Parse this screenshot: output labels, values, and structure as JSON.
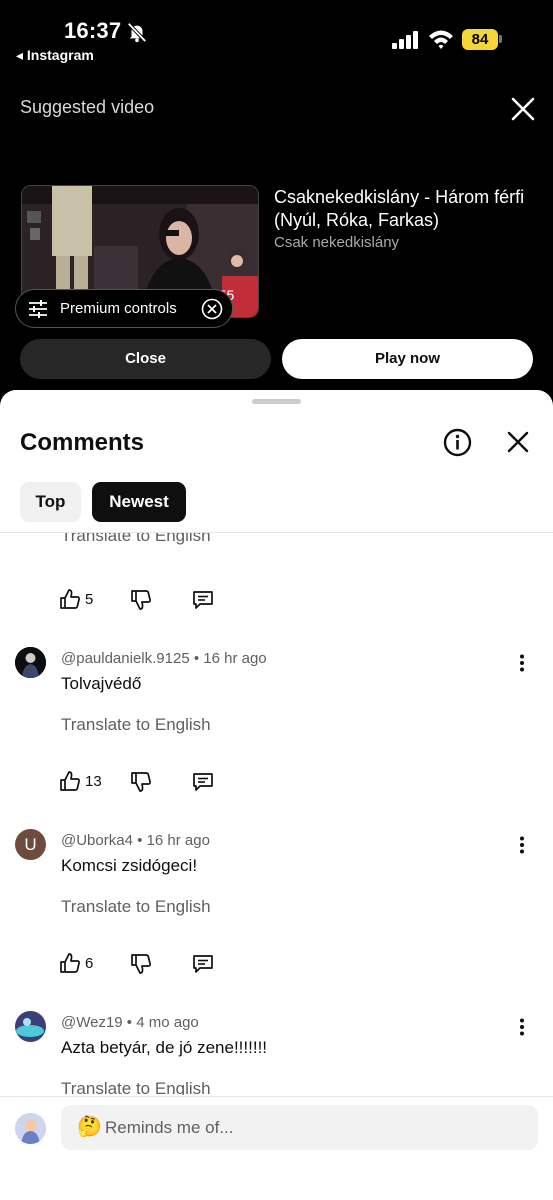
{
  "status_bar": {
    "time": "16:37",
    "back_app": "◂ Instagram",
    "battery": "84"
  },
  "suggested": {
    "label": "Suggested video",
    "video_title": "Csaknekedkislány - Három férfi (Nyúl, Róka, Farkas)",
    "channel": "Csak nekedkislány",
    "duration": "3:55",
    "premium_controls": "Premium controls",
    "close_button": "Close",
    "play_button": "Play now"
  },
  "comments": {
    "title": "Comments",
    "filters": [
      "Top",
      "Newest"
    ],
    "translate_label": "Translate to English",
    "partial_top": {
      "likes": "5"
    },
    "items": [
      {
        "author": "@pauldanielk.9125",
        "time": "16 hr ago",
        "text": "Tolvajvédő",
        "likes": "13",
        "avatar_icon": "photo-avatar"
      },
      {
        "author": "@Uborka4",
        "time": "16 hr ago",
        "text": "Komcsi zsidógeci!",
        "likes": "6",
        "avatar_letter": "U"
      },
      {
        "author": "@Wez19",
        "time": "4 mo ago",
        "text": "Azta betyár, de jó zene!!!!!!!",
        "avatar_icon": "photo-avatar"
      }
    ]
  },
  "input": {
    "emoji": "🤔",
    "placeholder": "Reminds me of..."
  },
  "colors": {
    "background_top": "#000000",
    "sheet": "#ffffff",
    "battery": "#f5d63a",
    "chip_active": "#0f0f0f",
    "chip_inactive": "#f0f0f0",
    "secondary_text": "#606060"
  }
}
